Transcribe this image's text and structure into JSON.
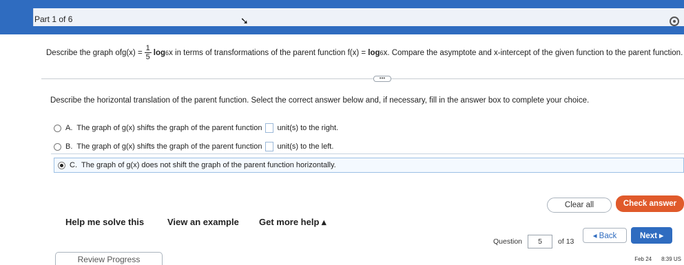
{
  "header": {
    "part": "Part 1 of 6"
  },
  "question": {
    "pre": "Describe the graph of ",
    "g_lhs": "g(x) =",
    "frac_num": "1",
    "frac_den": "5",
    "log": "log",
    "base": "6",
    "var": "x",
    "mid": " in terms of transformations of the parent function ",
    "f_lhs": "f(x) = ",
    "post": ". Compare the asymptote and x-intercept of the given function to the parent function."
  },
  "instruction": "Describe the horizontal translation of the parent function. Select the correct answer below and, if necessary, fill in the answer box to complete your choice.",
  "options": [
    {
      "letter": "A.",
      "text_before": "The graph of g(x) shifts the graph of the parent function",
      "text_after": "unit(s) to the right.",
      "selected": false
    },
    {
      "letter": "B.",
      "text_before": "The graph of g(x) shifts the graph of the parent function",
      "text_after": "unit(s) to the left.",
      "selected": false
    },
    {
      "letter": "C.",
      "text_before": "The graph of g(x) does not shift the graph of the parent function horizontally.",
      "text_after": "",
      "selected": true
    }
  ],
  "buttons": {
    "clear_all": "Clear all",
    "check_answer": "Check answer",
    "help_solve": "Help me solve this",
    "view_example": "View an example",
    "more_help": "Get more help ▴",
    "back": "◂ Back",
    "next": "Next ▸"
  },
  "nav": {
    "question_label": "Question",
    "question_number": "5",
    "of_total": "of 13"
  },
  "review": "Review Progress",
  "taskbar": {
    "date": "Feb 24",
    "time": "8:39 US"
  },
  "colors": {
    "brand_blue": "#2f6cc0",
    "check_orange": "#e05a2b"
  }
}
